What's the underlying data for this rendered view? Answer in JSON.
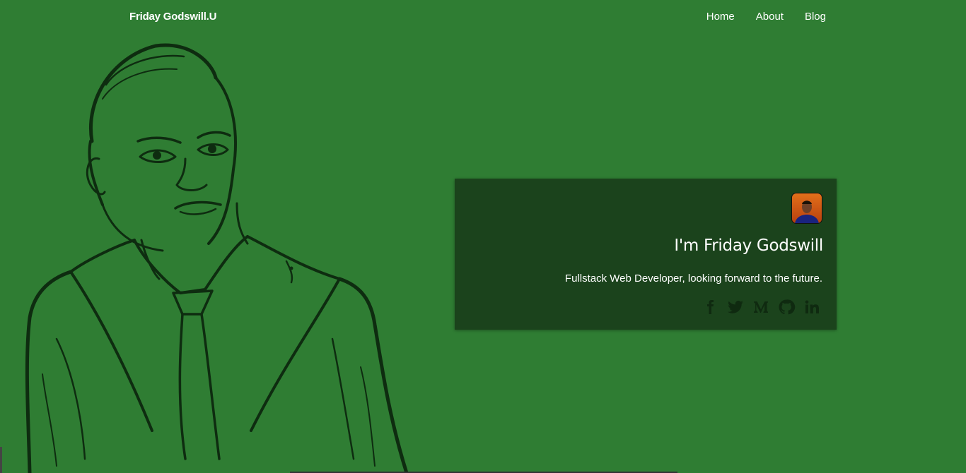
{
  "navbar": {
    "brand": "Friday Godswill.U",
    "links": [
      "Home",
      "About",
      "Blog"
    ]
  },
  "card": {
    "title": "I'm Friday Godswill",
    "subtitle": "Fullstack Web Developer, looking forward to the future.",
    "social_icons": [
      "facebook-icon",
      "twitter-icon",
      "medium-icon",
      "github-icon",
      "linkedin-icon"
    ]
  },
  "colors": {
    "background": "#2f7d33",
    "card_background": "#1b431c",
    "icon_color": "#0f2a10",
    "text": "#ffffff"
  }
}
